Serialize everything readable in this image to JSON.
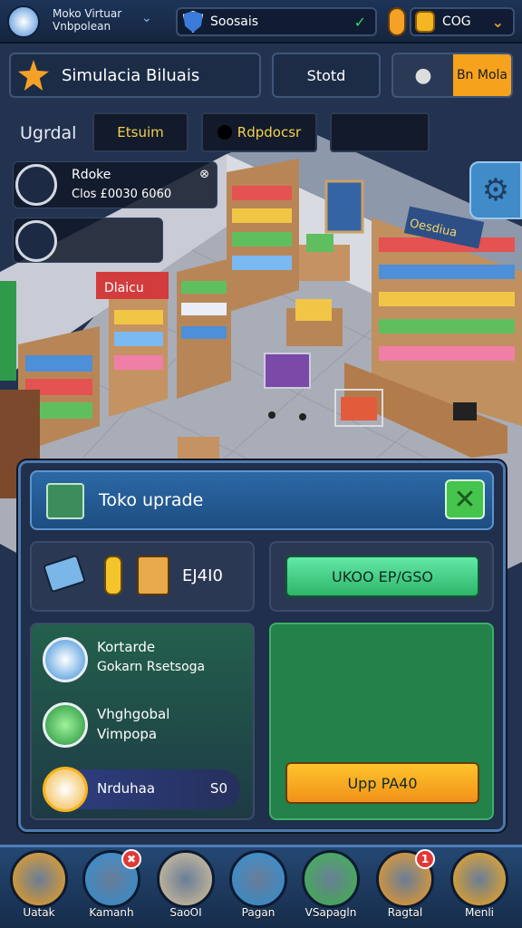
{
  "topbar": {
    "game_title": "Moko Virtuar\nVnbpolean",
    "store_pill_label": "Soosais",
    "currency_label": "COG"
  },
  "header": {
    "simulation_title": "Simulacia Biluais",
    "store_button": "Stotd",
    "shop_button": "Bn Mola"
  },
  "tabs": {
    "section_label": "Ugrdal",
    "tab_active": "Etsuim",
    "tab_second": "Rdpdocsr"
  },
  "notification": {
    "title": "Rdoke",
    "detail": "Clos £0030 6060"
  },
  "scene": {
    "store_sign_left": "Dlaicu",
    "store_sign_right": "Oesdiua"
  },
  "upgrade_panel": {
    "title": "Toko uprade",
    "cost_label": "EJ4I0",
    "cost_button": "UKOO EP/GSO",
    "item1_title": "Kortarde",
    "item1_sub": "Gokarn Rsetsoga",
    "item2_title": "Vhghgobal",
    "item2_sub": "Vimpopa",
    "item3_title": "Nrduhaa",
    "item3_value": "S0",
    "upgrade_button": "Upp PA40"
  },
  "nav": [
    {
      "label": "Uatak",
      "icon": "box-icon",
      "color": "#f2a11d",
      "badge": ""
    },
    {
      "label": "Kamanh",
      "icon": "crate-icon",
      "color": "#2f8fd6",
      "badge": "✖"
    },
    {
      "label": "SaoOI",
      "icon": "donut-icon",
      "color": "#d8c39c",
      "badge": ""
    },
    {
      "label": "Pagan",
      "icon": "mascot-icon",
      "color": "#2f8fd6",
      "badge": ""
    },
    {
      "label": "VSapagln",
      "icon": "ghost-icon",
      "color": "#3db64a",
      "badge": ""
    },
    {
      "label": "Ragtal",
      "icon": "package-icon",
      "color": "#f29c23",
      "badge": "1"
    },
    {
      "label": "Menli",
      "icon": "menu-icon",
      "color": "#f4a81c",
      "badge": ""
    }
  ],
  "colors": {
    "accent_green": "#3ed37c",
    "accent_orange": "#f6a21d",
    "panel_bg": "#1f2f4c"
  }
}
